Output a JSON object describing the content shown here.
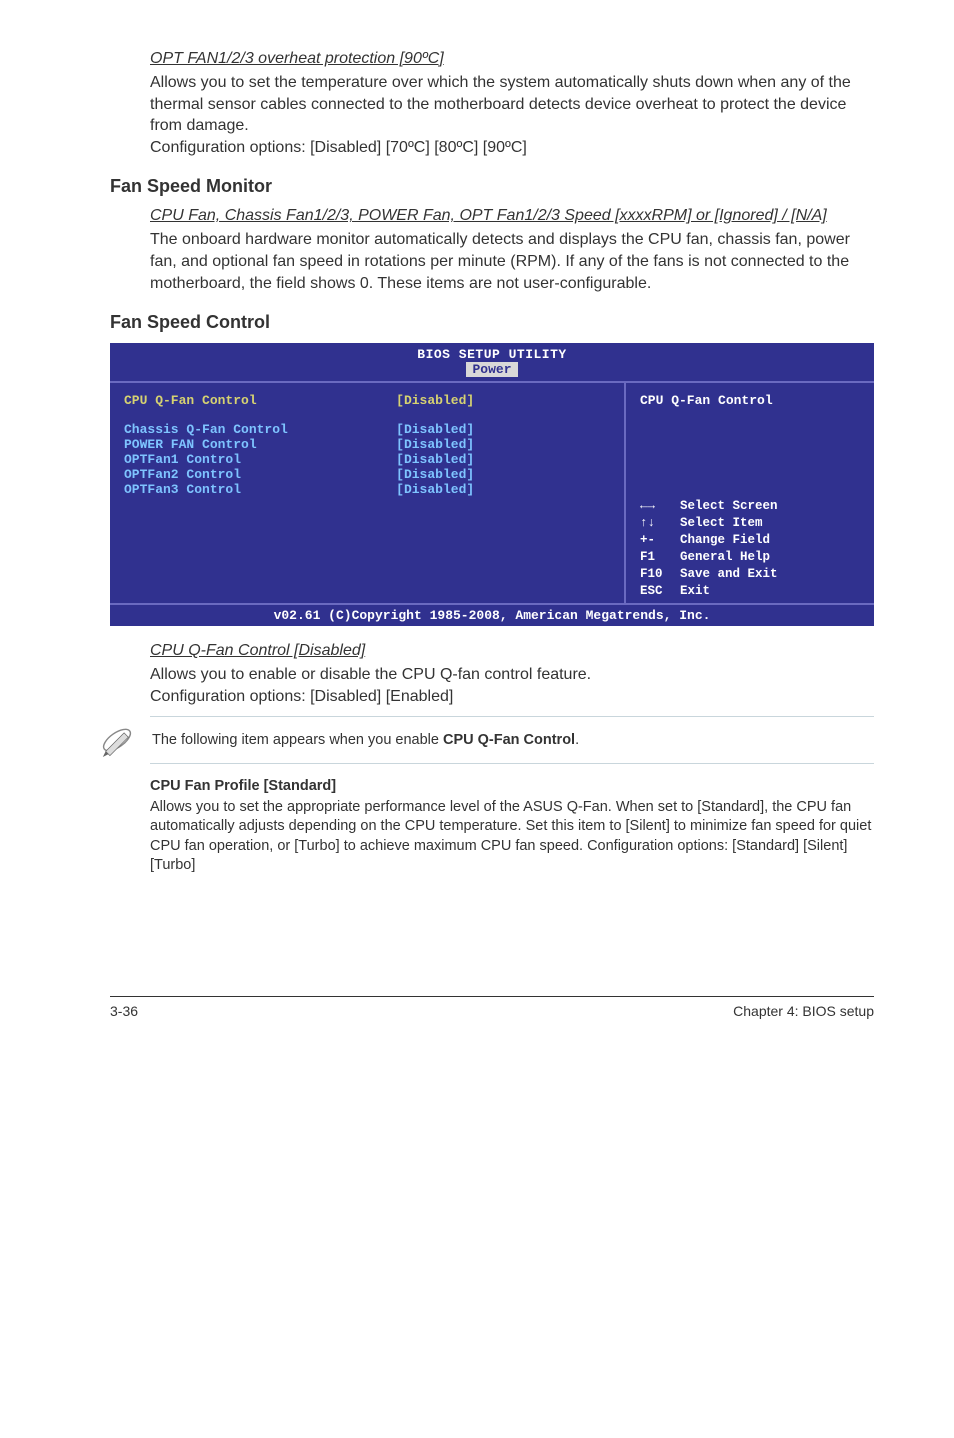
{
  "opt_fan": {
    "heading": "OPT FAN1/2/3 overheat protection [90ºC]",
    "body": "Allows you to set the temperature over which the system automatically shuts down when any of the thermal sensor cables connected to the motherboard detects device overheat to protect the device from damage.",
    "config": "Configuration options: [Disabled] [70ºC] [80ºC] [90ºC]"
  },
  "fan_speed_monitor": {
    "title": "Fan Speed Monitor",
    "sub_heading": "CPU Fan, Chassis Fan1/2/3, POWER Fan, OPT Fan1/2/3 Speed [xxxxRPM] or [Ignored] / [N/A]",
    "body": "The onboard hardware monitor automatically detects and displays the CPU fan, chassis fan, power fan, and optional fan speed in rotations per minute (RPM). If any of the fans is not connected to the motherboard, the field shows 0. These items are not user-configurable."
  },
  "fan_speed_control": {
    "title": "Fan Speed Control"
  },
  "bios": {
    "title": "BIOS SETUP UTILITY",
    "tab": "Power",
    "rows": [
      {
        "label": "CPU Q-Fan Control",
        "value": "[Disabled]",
        "main": true
      },
      {
        "label": "Chassis Q-Fan Control",
        "value": "[Disabled]"
      },
      {
        "label": "POWER FAN Control",
        "value": "[Disabled]"
      },
      {
        "label": "OPTFan1 Control",
        "value": "[Disabled]"
      },
      {
        "label": "OPTFan2 Control",
        "value": "[Disabled]"
      },
      {
        "label": "OPTFan3 Control",
        "value": "[Disabled]"
      }
    ],
    "help_title": "CPU Q-Fan Control",
    "help_keys": [
      {
        "key": "←→",
        "desc": "Select Screen"
      },
      {
        "key": "↑↓",
        "desc": "Select Item"
      },
      {
        "key": "+-",
        "desc": "Change Field"
      },
      {
        "key": "F1",
        "desc": "General Help"
      },
      {
        "key": "F10",
        "desc": "Save and Exit"
      },
      {
        "key": "ESC",
        "desc": "Exit"
      }
    ],
    "footer": "v02.61 (C)Copyright 1985-2008, American Megatrends, Inc."
  },
  "cpu_qfan": {
    "heading": "CPU Q-Fan Control [Disabled]",
    "body": "Allows you to enable or disable the CPU Q-fan control feature.",
    "config": "Configuration options: [Disabled] [Enabled]"
  },
  "note": {
    "text_pre": "The following item appears when you enable ",
    "text_bold": "CPU Q-Fan Control",
    "text_post": "."
  },
  "cpu_profile": {
    "heading": "CPU Fan Profile [Standard]",
    "body": "Allows you to set the appropriate performance level of the ASUS Q-Fan. When set to [Standard], the CPU fan automatically adjusts depending on the CPU temperature. Set this item to [Silent] to minimize fan speed for quiet CPU fan operation, or [Turbo] to achieve maximum CPU fan speed. Configuration options: [Standard] [Silent] [Turbo]"
  },
  "footer": {
    "left": "3-36",
    "right": "Chapter 4: BIOS setup"
  }
}
